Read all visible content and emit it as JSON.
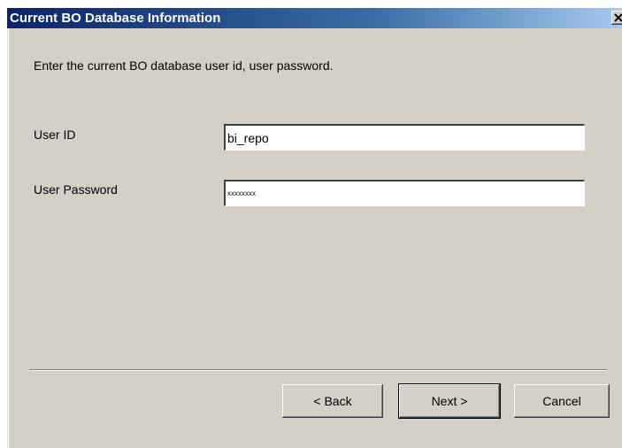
{
  "dialog": {
    "title": "Current BO Database Information",
    "instruction": "Enter the current BO database user id, user password."
  },
  "fields": {
    "user_id_label": "User ID",
    "user_id_value": "bi_repo",
    "password_label": "User Password",
    "password_value": "xxxxxxxx"
  },
  "buttons": {
    "back_label": "< Back",
    "next_label": "Next >",
    "cancel_label": "Cancel"
  },
  "icons": {
    "close": "close-icon"
  },
  "colors": {
    "title_bar_start": "#0a246a",
    "title_bar_end": "#a6caf0",
    "dialog_face": "#d4d0c8"
  }
}
